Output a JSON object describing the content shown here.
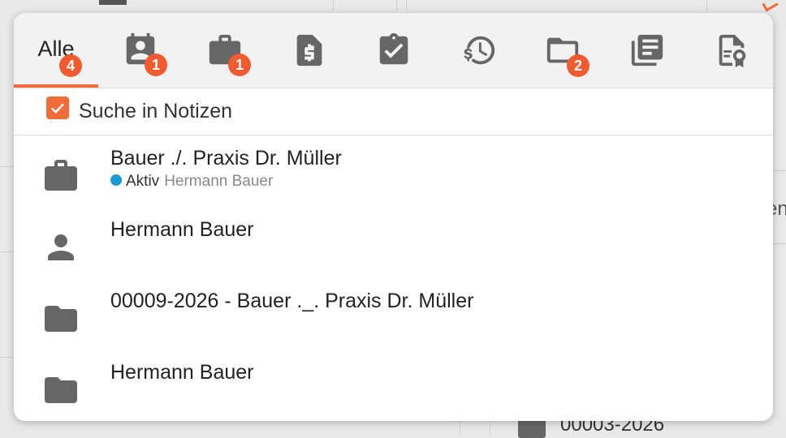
{
  "tabs": [
    {
      "id": "all",
      "label": "Alle",
      "icon": "text",
      "badge": "4",
      "active": true
    },
    {
      "id": "contacts",
      "icon": "contact-icon",
      "badge": "1"
    },
    {
      "id": "cases",
      "icon": "briefcase-icon",
      "badge": "1"
    },
    {
      "id": "invoices",
      "icon": "invoice-icon",
      "badge": ""
    },
    {
      "id": "tasks",
      "icon": "clipboard-check-icon",
      "badge": ""
    },
    {
      "id": "time",
      "icon": "time-money-icon",
      "badge": ""
    },
    {
      "id": "files",
      "icon": "folder-icon",
      "badge": "2"
    },
    {
      "id": "documents",
      "icon": "documents-icon",
      "badge": ""
    },
    {
      "id": "certificates",
      "icon": "certificate-icon",
      "badge": ""
    }
  ],
  "notes_search": {
    "label": "Suche in Notizen",
    "checked": true
  },
  "results": [
    {
      "icon": "briefcase-icon",
      "title": "Bauer ./. Praxis Dr. Müller",
      "status": "Aktiv",
      "client": "Hermann Bauer"
    },
    {
      "icon": "person-icon",
      "title": "Hermann Bauer"
    },
    {
      "icon": "folder-icon",
      "title": "00009-2026 - Bauer ._. Praxis Dr. Müller"
    },
    {
      "icon": "folder-icon",
      "title": "Hermann Bauer"
    }
  ],
  "background": {
    "right_fragment": "en",
    "bottom_fragment": "00003-2026"
  },
  "colors": {
    "accent": "#f26b3a",
    "badge": "#f25b2f",
    "status_active": "#1a9bd1",
    "icon": "#666666"
  }
}
